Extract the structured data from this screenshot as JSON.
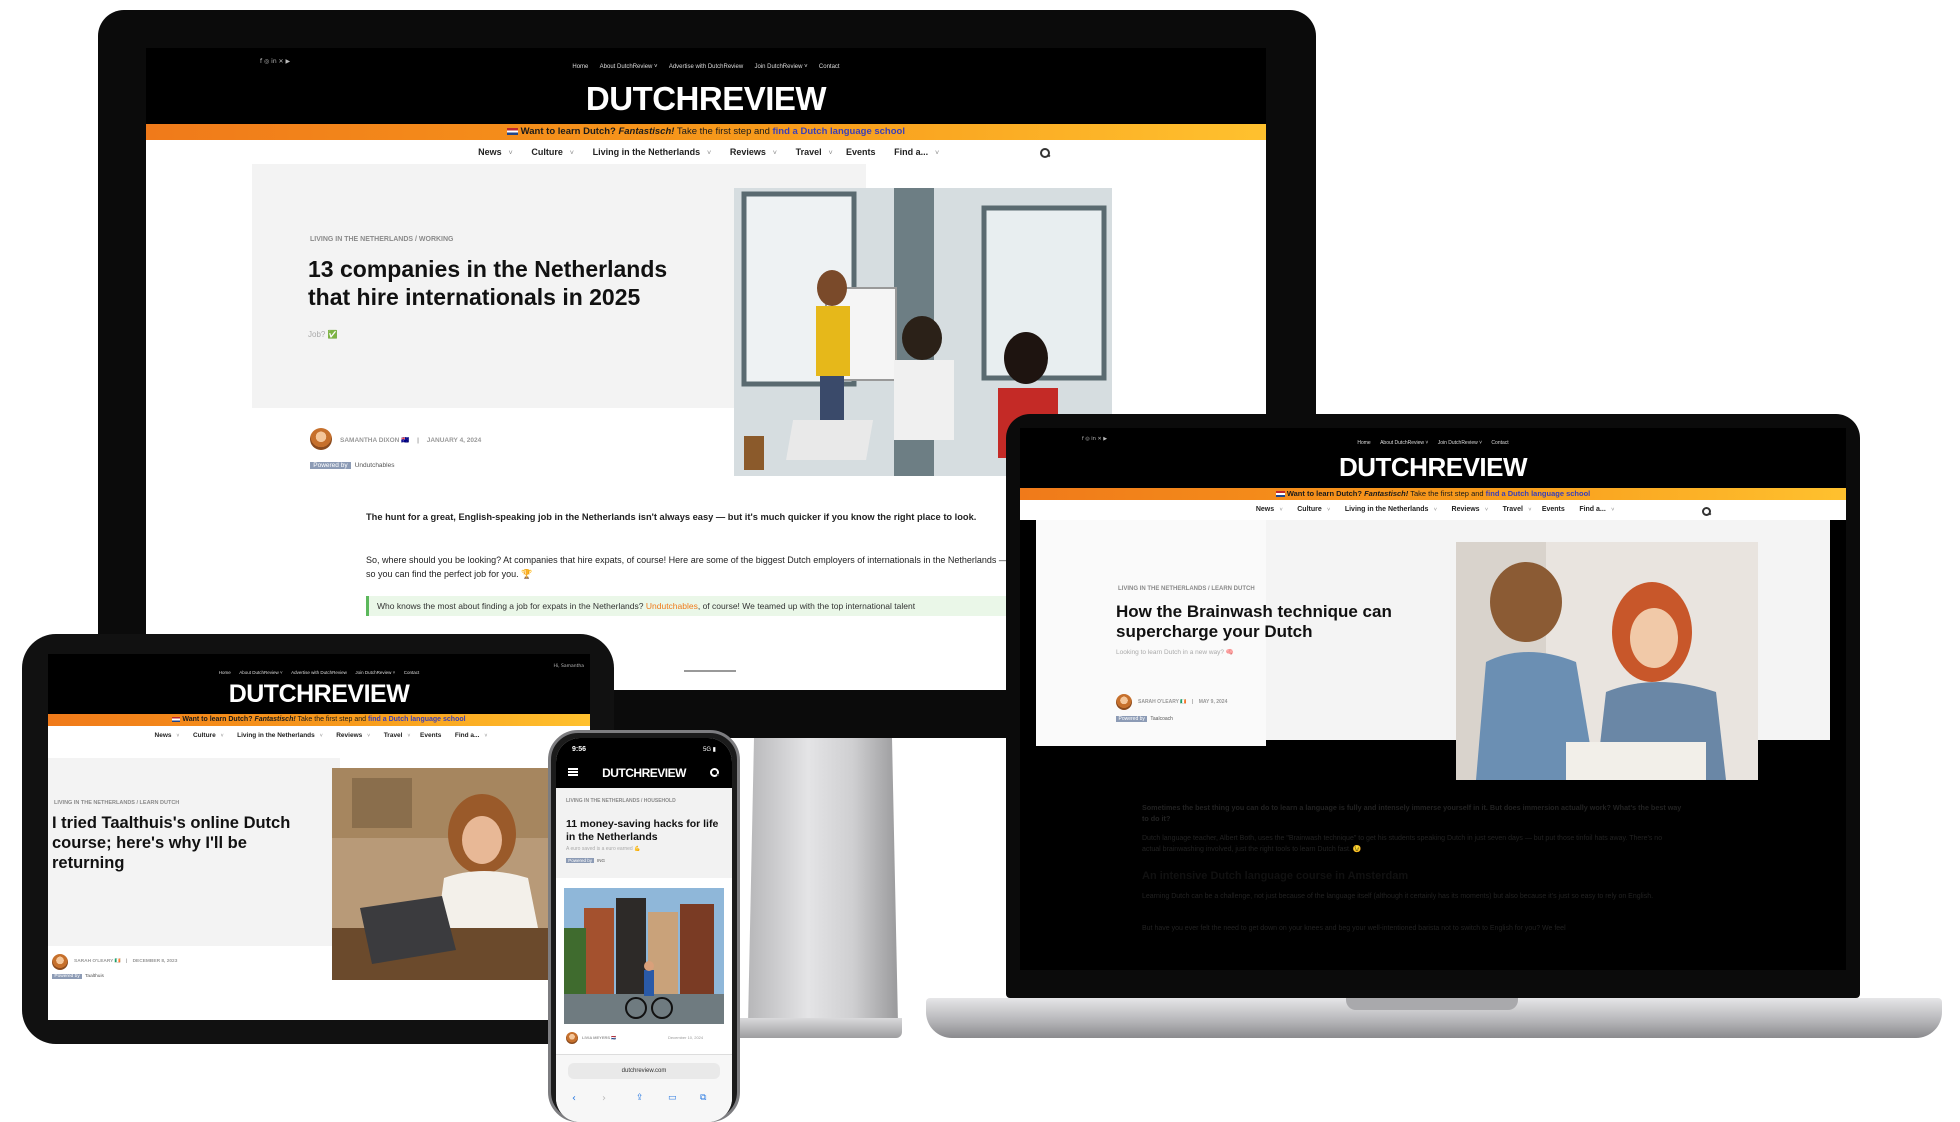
{
  "brand": {
    "logo": "DUTCHREVIEW",
    "social": "f ◎ in ✕ ▶",
    "accent": "#f07a1a",
    "link_color": "#3a3fb8"
  },
  "banner": {
    "flag": "🇳🇱",
    "lead": "Want to learn Dutch?",
    "word": "Fantastisch!",
    "middle": "Take the first step and",
    "link": "find a Dutch language school"
  },
  "topnav": [
    "Home",
    "About DutchReview ˅",
    "Advertise with DutchReview",
    "Join DutchReview ˅",
    "Contact"
  ],
  "menu": [
    "News",
    "Culture",
    "Living in the Netherlands",
    "Reviews",
    "Travel",
    "Events",
    "Find a..."
  ],
  "imac": {
    "crumb": "LIVING IN THE NETHERLANDS / WORKING",
    "title": "13 companies in the Netherlands that hire internationals in 2025",
    "subtitle": "Job? ✅",
    "author": "SAMANTHA DIXON 🇦🇺",
    "date": "JANUARY 4, 2024",
    "powered": "Powered by",
    "sponsor": "Undutchables",
    "intro": "The hunt for a great, English-speaking job in the Netherlands isn't always easy — but it's much quicker if you know the right place to look.",
    "para": "So, where should you be looking? At companies that hire expats, of course! Here are some of the biggest Dutch employers of internationals in the Netherlands — so you can find the perfect job for you. 🏆",
    "callout_pre": "Who knows the most about finding a job for expats in the Netherlands?",
    "callout_link": "Undutchables",
    "callout_post": ", of course! We teamed up with the top international talent"
  },
  "laptop": {
    "crumb": "LIVING IN THE NETHERLANDS / LEARN DUTCH",
    "title": "How the Brainwash technique can supercharge your Dutch",
    "subtitle": "Looking to learn Dutch in a new way? 🧠",
    "author": "SARAH O'LEARY 🇮🇪",
    "date": "MAY 9, 2024",
    "powered": "Powered by",
    "sponsor": "Taalcoach",
    "intro": "Sometimes the best thing you can do to learn a language is fully and intensely immerse yourself in it. But does immersion actually work? What's the best way to do it?",
    "para": "Dutch language teacher, Albert Both, uses the \"Brainwash technique\" to get his students speaking Dutch in just seven days — but put those tinfoil hats away. There's no actual brainwashing involved, just the right tools to learn Dutch fast. 😉",
    "heading": "An intensive Dutch language course in Amsterdam",
    "para2": "Learning Dutch can be a challenge, not just because of the language itself (although it certainly has its moments) but also because it's just so easy to rely on English.",
    "para3": "But have you ever felt the need to get down on your knees and beg your well-intentioned barista not to switch to English for you? We feel"
  },
  "tablet": {
    "crumb": "LIVING IN THE NETHERLANDS / LEARN DUTCH",
    "title": "I tried Taalthuis's online Dutch course; here's why I'll be returning",
    "author": "SARAH O'LEARY 🇮🇪",
    "date": "DECEMBER 8, 2023",
    "powered": "Powered by",
    "sponsor": "Taalthuis",
    "user": "Hi, Samantha"
  },
  "phone": {
    "time": "9:56",
    "status": "5G ▮",
    "logo": "DUTCHREVIEW",
    "crumb": "LIVING IN THE NETHERLANDS / HOUSEHOLD",
    "title": "11 money-saving hacks for life in the Netherlands",
    "subtitle": "A euro saved is a euro earned 💪",
    "powered": "Powered by",
    "sponsor": "ING",
    "author": "LIVIA MEYERS 🇳🇱",
    "date": "December 10, 2024",
    "url": "dutchreview.com"
  }
}
